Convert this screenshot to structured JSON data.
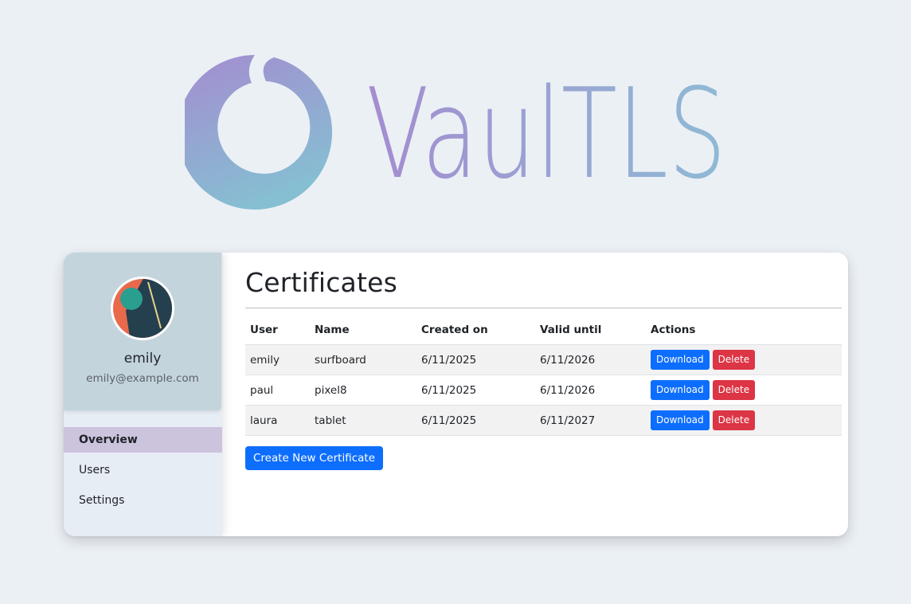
{
  "app": {
    "logo_text": "VaulTLS"
  },
  "user": {
    "name": "emily",
    "email": "emily@example.com"
  },
  "nav": {
    "items": [
      {
        "label": "Overview",
        "active": true
      },
      {
        "label": "Users",
        "active": false
      },
      {
        "label": "Settings",
        "active": false
      }
    ]
  },
  "main": {
    "title": "Certificates",
    "columns": [
      "User",
      "Name",
      "Created on",
      "Valid until",
      "Actions"
    ],
    "rows": [
      {
        "user": "emily",
        "name": "surfboard",
        "created": "6/11/2025",
        "valid": "6/11/2026",
        "download": "Download",
        "delete": "Delete"
      },
      {
        "user": "paul",
        "name": "pixel8",
        "created": "6/11/2025",
        "valid": "6/11/2026",
        "download": "Download",
        "delete": "Delete"
      },
      {
        "user": "laura",
        "name": "tablet",
        "created": "6/11/2025",
        "valid": "6/11/2027",
        "download": "Download",
        "delete": "Delete"
      }
    ],
    "create_button": "Create New Certificate"
  },
  "colors": {
    "primary": "#0d6efd",
    "danger": "#dc3545",
    "nav_active": "#ccc3dd",
    "profile_bg": "#c3d4dd",
    "logo_gradient_start": "#a48cd0",
    "logo_gradient_end": "#88bcd0"
  }
}
